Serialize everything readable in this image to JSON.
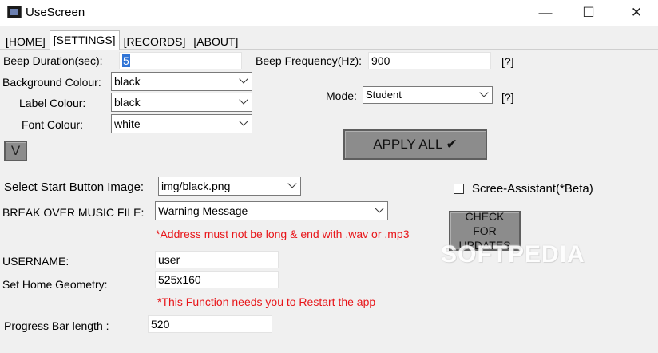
{
  "window": {
    "title": "UseScreen",
    "minimize": "—",
    "maximize": "☐",
    "close": "✕"
  },
  "tabs": [
    "[HOME]",
    "[SETTINGS]",
    "[RECORDS]",
    "[ABOUT]"
  ],
  "settings": {
    "beep_duration_label": "Beep Duration(sec):",
    "beep_duration_value": "5",
    "beep_frequency_label": "Beep Frequency(Hz):",
    "beep_frequency_value": "900",
    "help1": "[?]",
    "bg_colour_label": "Background Colour:",
    "bg_colour_value": "black",
    "label_colour_label": "Label Colour:",
    "label_colour_value": "black",
    "font_colour_label": "Font Colour:",
    "font_colour_value": "white",
    "mode_label": "Mode:",
    "mode_value": "Student",
    "help2": "[?]",
    "v_button": "V",
    "apply_all": "APPLY ALL ✔",
    "start_image_label": "Select Start Button Image:",
    "start_image_value": "img/black.png",
    "assistant_label": "Scree-Assistant(*Beta)",
    "music_label": "BREAK OVER MUSIC FILE:",
    "music_value": "Warning Message",
    "music_note": "*Address must not be long & end with .wav or .mp3",
    "check_updates": "CHECK FOR UPDATES",
    "username_label": "USERNAME:",
    "username_value": "user",
    "geometry_label": "Set Home Geometry:",
    "geometry_value": "525x160",
    "restart_note": "*This Function needs you to Restart the app",
    "progress_label": "Progress Bar length :",
    "progress_value": "520"
  },
  "watermark": "SOFTPEDIA"
}
